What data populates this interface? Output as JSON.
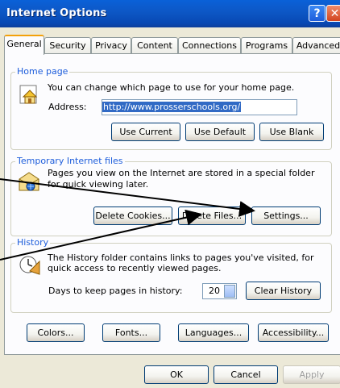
{
  "window": {
    "title": "Internet Options",
    "help_glyph": "?",
    "close_glyph": "✕"
  },
  "tabs": [
    "General",
    "Security",
    "Privacy",
    "Content",
    "Connections",
    "Programs",
    "Advanced"
  ],
  "home_page": {
    "legend": "Home page",
    "description": "You can change which page to use for your home page.",
    "address_label": "Address:",
    "address_value": "http://www.prosserschools.org/",
    "use_current": "Use Current",
    "use_default": "Use Default",
    "use_blank": "Use Blank"
  },
  "temp_files": {
    "legend": "Temporary Internet files",
    "line1": "Pages you view on the Internet are stored in a special folder",
    "line2": "for quick viewing later.",
    "delete_cookies": "Delete Cookies...",
    "delete_files": "Delete Files...",
    "settings": "Settings..."
  },
  "history": {
    "legend": "History",
    "line1": "The History folder contains links to pages you've visited, for",
    "line2": "quick access to recently viewed pages.",
    "days_label": "Days to keep pages in history:",
    "days_value": "20",
    "clear_history": "Clear History"
  },
  "bottom_buttons": {
    "colors": "Colors...",
    "fonts": "Fonts...",
    "languages": "Languages...",
    "accessibility": "Accessibility..."
  },
  "dialog_buttons": {
    "ok": "OK",
    "cancel": "Cancel",
    "apply": "Apply"
  },
  "colors": {
    "title_bar": "#0A61D8",
    "dialog_bg": "#ECE9D8",
    "tab_highlight": "#F3A10B",
    "legend_text": "#1D5DDB",
    "annotation_arrow": "#000000"
  }
}
